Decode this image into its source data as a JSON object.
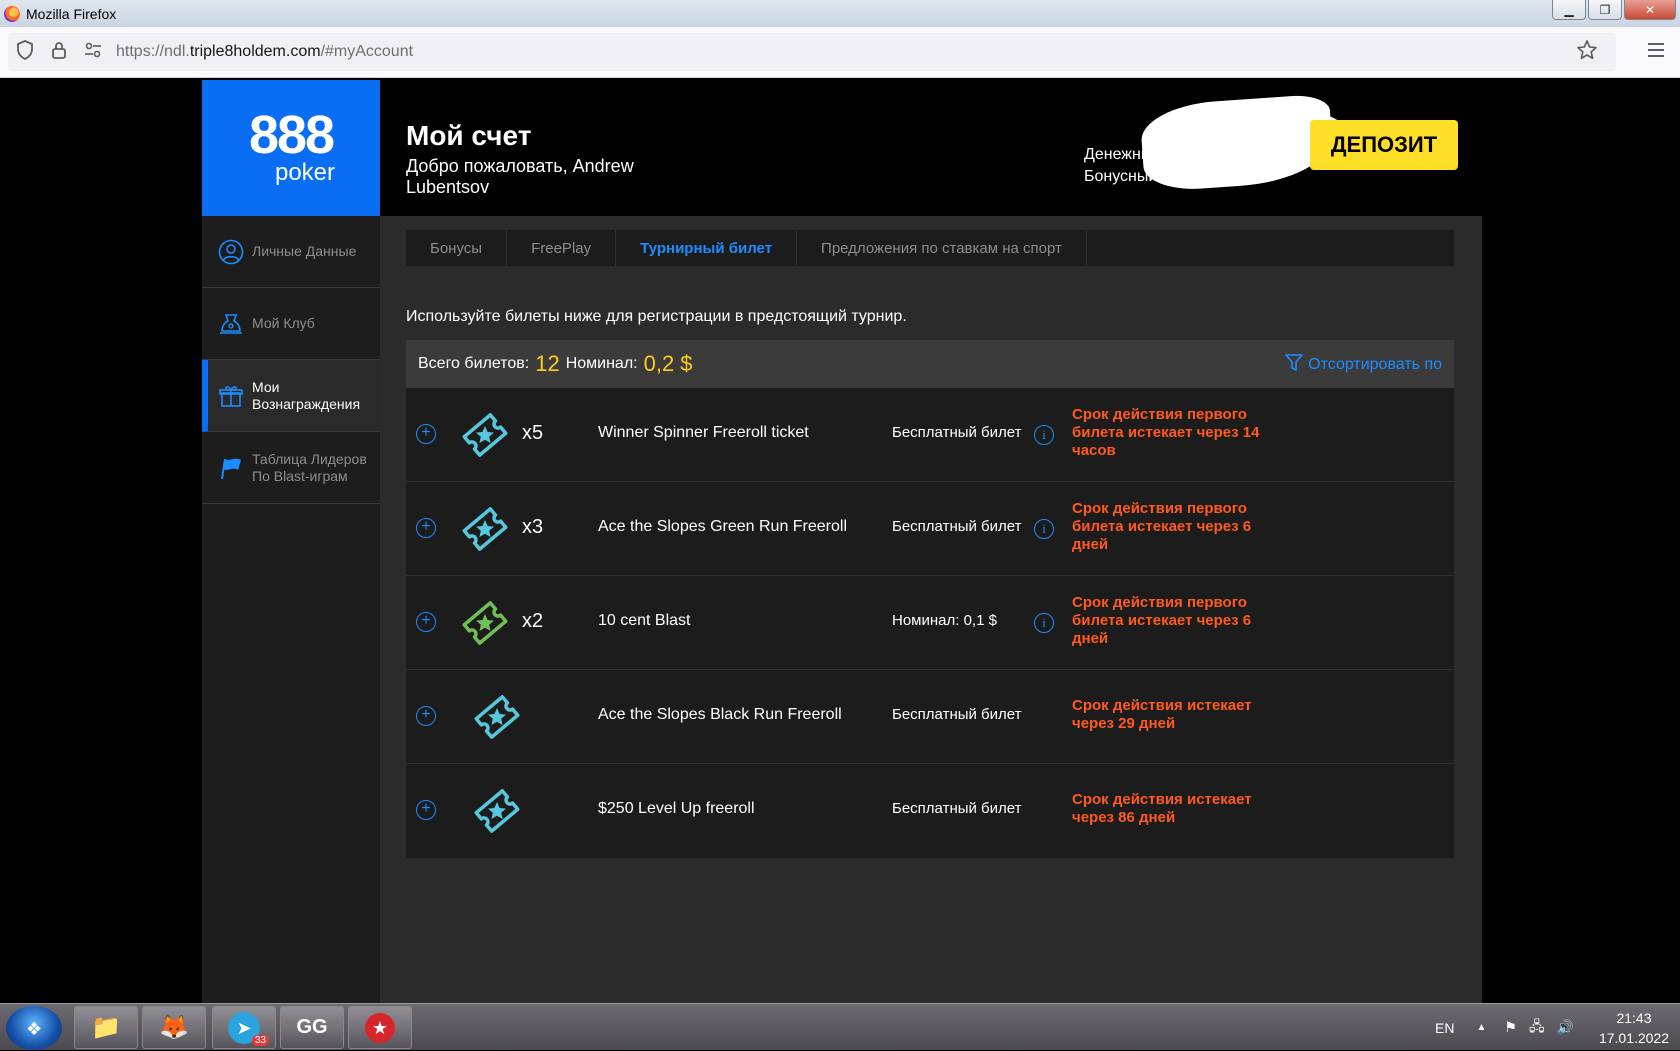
{
  "browser": {
    "window_title": "Mozilla Firefox",
    "url_prefix": "https://ndl.",
    "url_domain": "triple8holdem.com",
    "url_suffix": "/#myAccount",
    "window_buttons": {
      "minimize": "▁",
      "maximize": "❐",
      "close": "✕"
    }
  },
  "header": {
    "logo_number": "888",
    "logo_word": "poker",
    "title": "Мой счет",
    "welcome": "Добро пожаловать, Andrew Lubentsov",
    "cash_balance_label": "Денежный балан",
    "bonus_balance_label": "Бонусный баланс:",
    "deposit_label": "ДЕПОЗИТ"
  },
  "sidebar": {
    "items": [
      {
        "label": "Личные Данные",
        "icon": "user-icon"
      },
      {
        "label": "Мой Клуб",
        "icon": "club-icon"
      },
      {
        "label": "Мои Вознаграждения",
        "icon": "gift-icon"
      },
      {
        "label": "Таблица Лидеров По Blast-играм",
        "icon": "flag-icon"
      }
    ]
  },
  "tabs": [
    {
      "label": "Бонусы"
    },
    {
      "label": "FreePlay"
    },
    {
      "label": "Турнирный билет"
    },
    {
      "label": "Предложения по ставкам на спорт"
    }
  ],
  "content": {
    "intro": "Используйте билеты ниже для регистрации в предстоящий турнир.",
    "total_label": "Всего билетов:",
    "total_value": "12",
    "nominal_label": "Номинал:",
    "nominal_value": "0,2 $",
    "sort_label": "Отсортировать по"
  },
  "tickets": [
    {
      "count": "x5",
      "name": "Winner Spinner Freeroll ticket",
      "type": "Бесплатный билет",
      "info": "i",
      "expire": "Срок действия первого билета истекает через 14 часов",
      "color": "#57c8dc"
    },
    {
      "count": "x3",
      "name": "Ace the Slopes Green Run Freeroll",
      "type": "Бесплатный билет",
      "info": "i",
      "expire": "Срок действия первого билета истекает через 6 дней",
      "color": "#57c8dc"
    },
    {
      "count": "x2",
      "name": "10 cent Blast",
      "type": "Номинал: 0,1 $",
      "info": "i",
      "expire": "Срок действия первого билета истекает через 6 дней",
      "color": "#6fbf55"
    },
    {
      "count": "",
      "name": "Ace the Slopes Black Run Freeroll",
      "type": "Бесплатный билет",
      "info": "",
      "expire": "Срок действия истекает через 29 дней",
      "color": "#57c8dc"
    },
    {
      "count": "",
      "name": "$250 Level Up freeroll",
      "type": "Бесплатный билет",
      "info": "",
      "expire": "Срок действия истекает через 86 дней",
      "color": "#57c8dc"
    }
  ],
  "taskbar": {
    "badge": "33",
    "language": "EN",
    "time": "21:43",
    "date": "17.01.2022"
  },
  "colors": {
    "brand_blue": "#0a6ef4",
    "accent_yellow": "#ffde27",
    "link_blue": "#1d8cff",
    "warning_orange": "#ff5a1f"
  }
}
